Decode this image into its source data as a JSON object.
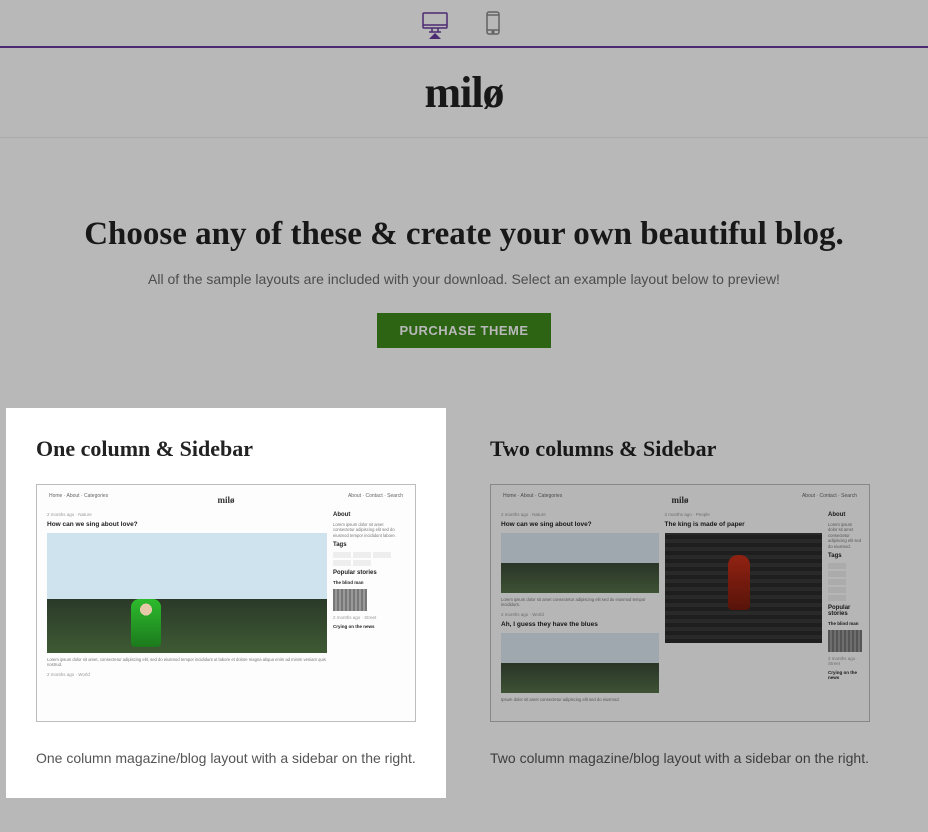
{
  "brand": "milø",
  "hero": {
    "headline": "Choose any of these & create your own beautiful blog.",
    "subline": "All of the sample layouts are included with your download. Select an example layout below to preview!",
    "cta": "PURCHASE THEME"
  },
  "layouts": [
    {
      "title": "One column & Sidebar",
      "description": "One column magazine/blog layout with a sidebar on the right.",
      "active": true
    },
    {
      "title": "Two columns & Sidebar",
      "description": "Two column magazine/blog layout with a sidebar on the right.",
      "active": false
    }
  ],
  "preview": {
    "brand": "milø",
    "post1": "How can we sing about love?",
    "post2": "The king is made of paper",
    "post3": "Ah, I guess they have the blues",
    "about": "About",
    "tags": "Tags",
    "popular": "Popular stories"
  }
}
